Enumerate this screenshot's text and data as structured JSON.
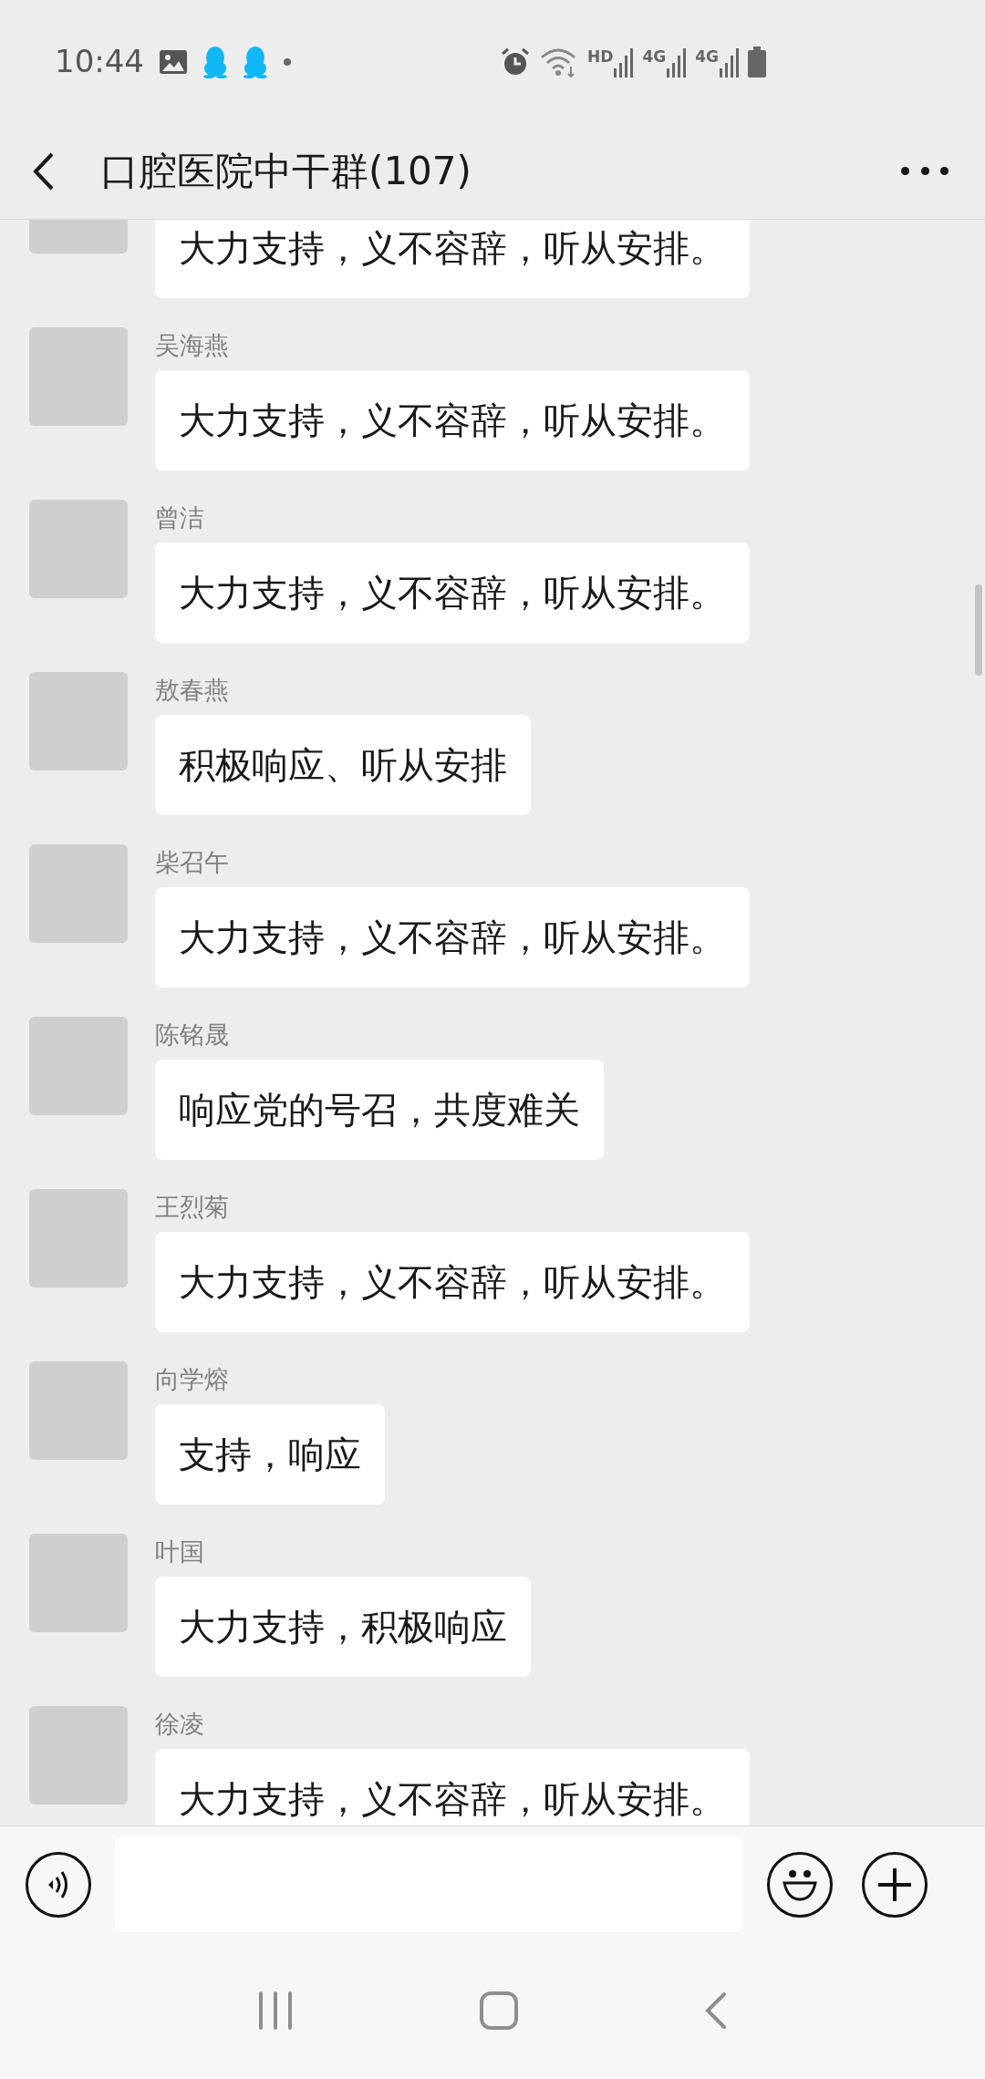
{
  "status_bar": {
    "time": "10:44",
    "network_labels": [
      "HD",
      "4G",
      "4G"
    ]
  },
  "header": {
    "title": "口腔医院中干群(107)"
  },
  "messages": [
    {
      "text": "大力支持，义不容辞，听从安排。"
    },
    {
      "sender": "吴海燕",
      "text": "大力支持，义不容辞，听从安排。"
    },
    {
      "sender": "曾洁",
      "text": "大力支持，义不容辞，听从安排。"
    },
    {
      "sender": "敖春燕",
      "text": "积极响应、听从安排"
    },
    {
      "sender": "柴召午",
      "text": "大力支持，义不容辞，听从安排。"
    },
    {
      "sender": "陈铭晟",
      "text": "响应党的号召，共度难关"
    },
    {
      "sender": "王烈菊",
      "text": "大力支持，义不容辞，听从安排。"
    },
    {
      "sender": "向学熔",
      "text": "支持，响应"
    },
    {
      "sender": "叶国",
      "text": "大力支持，积极响应"
    },
    {
      "sender": "徐凌",
      "text": "大力支持，义不容辞，听从安排。"
    }
  ]
}
